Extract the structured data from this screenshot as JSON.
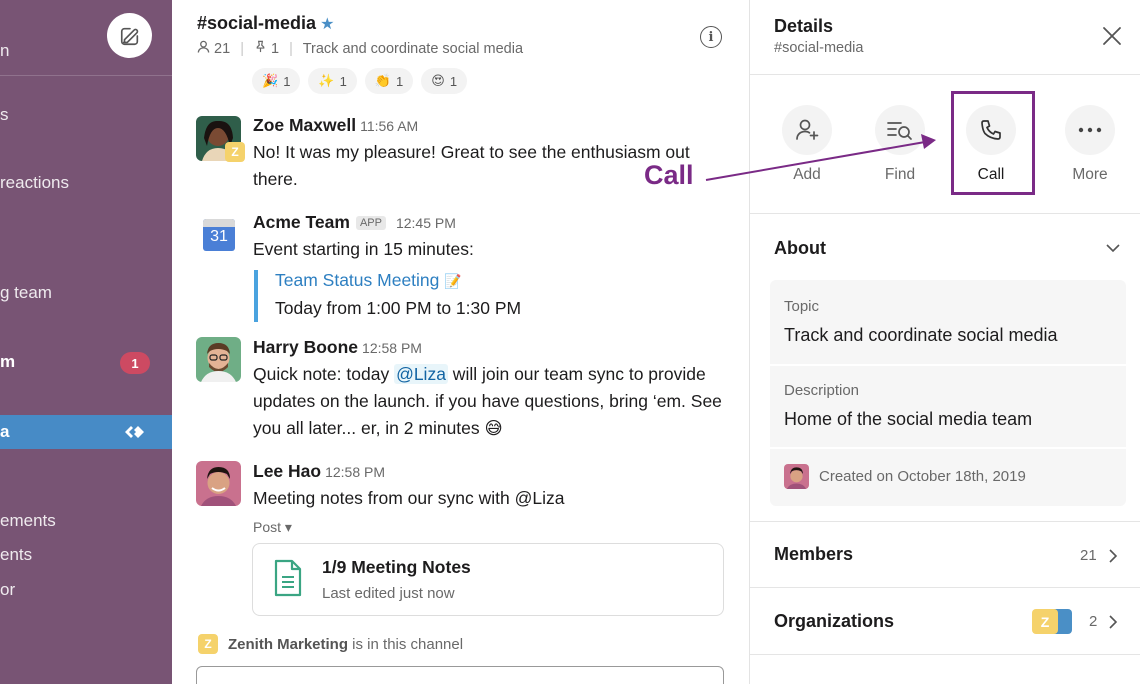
{
  "sidebar": {
    "items": [
      {
        "text": "n"
      },
      {
        "text": "s"
      },
      {
        "text": "reactions"
      },
      {
        "text": "g team"
      },
      {
        "text": "m"
      },
      {
        "text": "a"
      },
      {
        "text": "ements"
      },
      {
        "text": "ents"
      },
      {
        "text": "or"
      }
    ],
    "badge": "1"
  },
  "channel": {
    "name": "#social-media",
    "members": "21",
    "pins": "1",
    "topic": "Track and coordinate social media",
    "reactions": [
      {
        "emoji": "🎉",
        "count": "1"
      },
      {
        "emoji": "✨",
        "count": "1"
      },
      {
        "emoji": "👏",
        "count": "1"
      },
      {
        "emoji": "😍",
        "count": "1"
      }
    ],
    "messages": [
      {
        "name": "Zoe Maxwell",
        "time": "11:56 AM",
        "text": "No! It was my pleasure! Great to see the enthusiasm out there."
      },
      {
        "name": "Acme Team",
        "tag": "APP",
        "time": "12:45 PM",
        "text": "Event starting in 15 minutes:",
        "event_title": "Team Status Meeting",
        "event_emoji": "📝",
        "event_time": "Today from 1:00 PM to 1:30 PM",
        "calendar_day": "31"
      },
      {
        "name": "Harry Boone",
        "time": "12:58 PM",
        "text_before": "Quick note: today ",
        "mention": "@Liza",
        "text_after": " will join our team sync to provide updates on the launch. if you have questions, bring ‘em. See you all later... er, in 2 minutes 😅"
      },
      {
        "name": "Lee Hao",
        "time": "12:58 PM",
        "text": "Meeting notes from our sync with @Liza",
        "post_label": "Post ▾",
        "post_title": "1/9 Meeting Notes",
        "post_sub": "Last edited just now"
      }
    ],
    "joined_org": "Zenith Marketing",
    "joined_text": " is in this channel",
    "z_badge": "Z"
  },
  "details": {
    "title": "Details",
    "subtitle": "#social-media",
    "actions": [
      {
        "label": "Add"
      },
      {
        "label": "Find"
      },
      {
        "label": "Call"
      },
      {
        "label": "More"
      }
    ],
    "about_label": "About",
    "topic_label": "Topic",
    "topic_value": "Track and coordinate social media",
    "description_label": "Description",
    "description_value": "Home of the social media team",
    "created": "Created on October 18th, 2019",
    "members_label": "Members",
    "members_count": "21",
    "orgs_label": "Organizations",
    "orgs_count": "2",
    "orgs_badge": "Z"
  },
  "annotation": {
    "text": "Call",
    "color": "#7a2a86"
  },
  "colors": {
    "sidebar": "#785474",
    "selected": "#478bc6",
    "badge": "#cd4a62",
    "link": "#2d7fc1"
  }
}
